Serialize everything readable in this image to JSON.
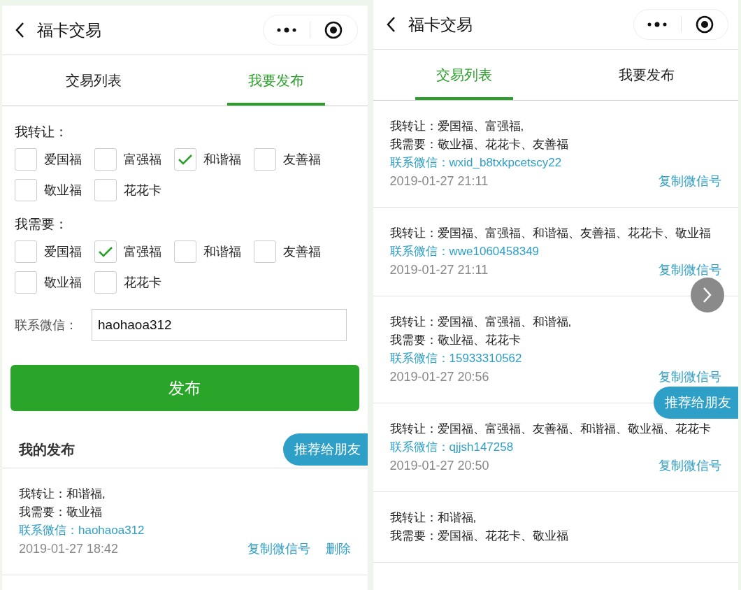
{
  "screens": [
    {
      "kind": "publish",
      "title": "福卡交易",
      "tabs": [
        {
          "label": "交易列表",
          "selected": false
        },
        {
          "label": "我要发布",
          "selected": true
        }
      ],
      "groups": [
        {
          "label": "我转让：",
          "options": [
            {
              "label": "爱国福",
              "checked": false
            },
            {
              "label": "富强福",
              "checked": false
            },
            {
              "label": "和谐福",
              "checked": true
            },
            {
              "label": "友善福",
              "checked": false
            },
            {
              "label": "敬业福",
              "checked": false
            },
            {
              "label": "花花卡",
              "checked": false
            }
          ]
        },
        {
          "label": "我需要：",
          "options": [
            {
              "label": "爱国福",
              "checked": false
            },
            {
              "label": "富强福",
              "checked": true
            },
            {
              "label": "和谐福",
              "checked": false
            },
            {
              "label": "友善福",
              "checked": false
            },
            {
              "label": "敬业福",
              "checked": false
            },
            {
              "label": "花花卡",
              "checked": false
            }
          ]
        }
      ],
      "contact": {
        "label": "联系微信：",
        "value": "haohaoa312"
      },
      "submit": "发布",
      "share": "推荐给朋友",
      "section_title": "我的发布",
      "items": [
        {
          "offer": "我转让：和谐福,",
          "need": "我需要：敬业福",
          "contact": "联系微信：haohaoa312",
          "time": "2019-01-27 18:42",
          "actions": [
            "复制微信号",
            "删除"
          ]
        }
      ]
    },
    {
      "kind": "list",
      "title": "福卡交易",
      "tabs": [
        {
          "label": "交易列表",
          "selected": true
        },
        {
          "label": "我要发布",
          "selected": false
        }
      ],
      "share": "推荐给朋友",
      "items": [
        {
          "offer": "我转让：爱国福、富强福,",
          "need": "我需要：敬业福、花花卡、友善福",
          "contact": "联系微信：wxid_b8txkpcetscy22",
          "time": "2019-01-27 21:11",
          "actions": [
            "复制微信号"
          ]
        },
        {
          "offer": "我转让：爱国福、富强福、和谐福、友善福、花花卡、敬业福",
          "contact": "联系微信：wwe1060458349",
          "time": "2019-01-27 21:11",
          "actions": [
            "复制微信号"
          ]
        },
        {
          "offer": "我转让：爱国福、富强福、和谐福,",
          "need": "我需要：敬业福、花花卡",
          "contact": "联系微信：15933310562",
          "time": "2019-01-27 20:56",
          "actions": [
            "复制微信号"
          ]
        },
        {
          "offer": "我转让：爱国福、富强福、友善福、和谐福、敬业福、花花卡",
          "contact": "联系微信：qjjsh147258",
          "time": "2019-01-27 20:50",
          "actions": [
            "复制微信号"
          ]
        },
        {
          "offer": "我转让：和谐福,",
          "need": "我需要：爱国福、花花卡、敬业福"
        }
      ]
    }
  ]
}
